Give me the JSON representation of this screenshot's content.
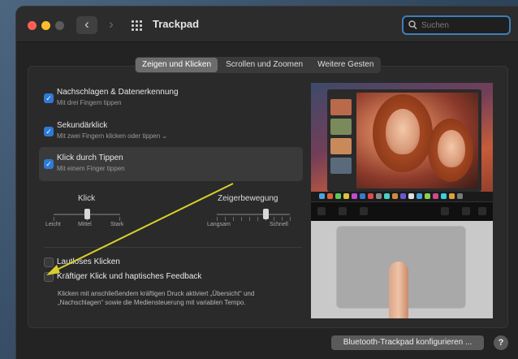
{
  "window": {
    "title": "Trackpad"
  },
  "search": {
    "placeholder": "Suchen"
  },
  "tabs": [
    {
      "label": "Zeigen und Klicken",
      "active": true
    },
    {
      "label": "Scrollen und Zoomen",
      "active": false
    },
    {
      "label": "Weitere Gesten",
      "active": false
    }
  ],
  "options": [
    {
      "title": "Nachschlagen & Datenerkennung",
      "subtitle": "Mit drei Fingern tippen",
      "checked": true
    },
    {
      "title": "Sekundärklick",
      "subtitle": "Mit zwei Fingern klicken oder tippen ⌄",
      "checked": true
    },
    {
      "title": "Klick durch Tippen",
      "subtitle": "Mit einem Finger tippen",
      "checked": true
    }
  ],
  "sliders": {
    "click": {
      "title": "Klick",
      "labels": [
        "Leicht",
        "Mittel",
        "Stark"
      ],
      "value": 0.5
    },
    "tracking": {
      "title": "Zeigerbewegung",
      "labels": [
        "Langsam",
        "Schnell"
      ],
      "value": 0.67
    }
  },
  "checks": [
    {
      "title": "Lautloses Klicken",
      "checked": false
    },
    {
      "title": "Kräftiger Klick und haptisches Feedback",
      "checked": false
    }
  ],
  "force_click_desc": "Klicken mit anschließendem kräftigen Druck aktiviert „Übersicht“ und „Nachschlagen“ sowie die Mediensteuerung mit variablen Tempo.",
  "buttons": {
    "configure": "Bluetooth-Trackpad konfigurieren ...",
    "help": "?"
  },
  "colors": {
    "accent": "#2e7ad6",
    "annotation_arrow": "#d8d02a"
  }
}
